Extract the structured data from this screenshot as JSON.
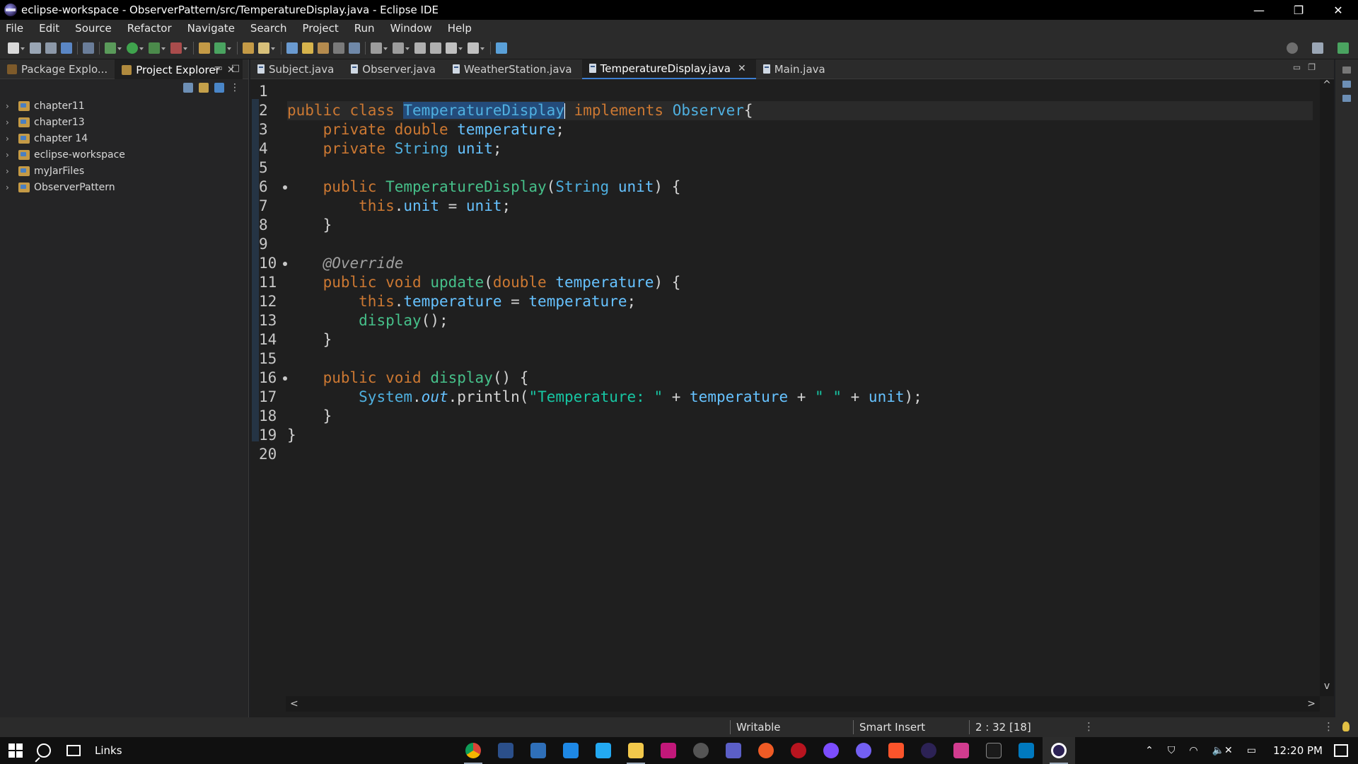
{
  "window": {
    "title": "eclipse-workspace - ObserverPattern/src/TemperatureDisplay.java - Eclipse IDE",
    "controls": {
      "minimize": "—",
      "restore": "❐",
      "close": "✕"
    }
  },
  "menu": [
    "File",
    "Edit",
    "Source",
    "Refactor",
    "Navigate",
    "Search",
    "Project",
    "Run",
    "Window",
    "Help"
  ],
  "left_panel": {
    "tabs": [
      {
        "label": "Package Explo..."
      },
      {
        "label": "Project Explorer",
        "close": "✕"
      }
    ],
    "projects": [
      "chapter11",
      "chapter13",
      "chapter 14",
      "eclipse-workspace",
      "myJarFiles",
      "ObserverPattern"
    ]
  },
  "editor": {
    "tabs": [
      {
        "label": "Subject.java"
      },
      {
        "label": "Observer.java"
      },
      {
        "label": "WeatherStation.java"
      },
      {
        "label": "TemperatureDisplay.java",
        "close": "✕"
      },
      {
        "label": "Main.java"
      }
    ],
    "line_numbers": [
      "1",
      "2",
      "3",
      "4",
      "5",
      "6",
      "7",
      "8",
      "9",
      "10",
      "11",
      "12",
      "13",
      "14",
      "15",
      "16",
      "17",
      "18",
      "19",
      "20"
    ],
    "code": {
      "l2": {
        "kw1": "public",
        "kw2": "class",
        "cls": "TemperatureDisplay",
        "kw3": "implements",
        "iface": "Observer",
        "brace": "{"
      },
      "l3": {
        "kw1": "private",
        "kw2": "double",
        "field": "temperature",
        "end": ";"
      },
      "l4": {
        "kw1": "private",
        "type": "String",
        "field": "unit",
        "end": ";"
      },
      "l6": {
        "kw1": "public",
        "ctor": "TemperatureDisplay",
        "open": "(",
        "type": "String",
        "param": "unit",
        "close": ") {"
      },
      "l7": {
        "kw": "this",
        "dot": ".",
        "field": "unit",
        "eq": " = ",
        "param": "unit",
        "end": ";"
      },
      "l8": {
        "brace": "}"
      },
      "l10": {
        "annotation": "@Override"
      },
      "l11": {
        "kw1": "public",
        "kw2": "void",
        "method": "update",
        "open": "(",
        "kw3": "double",
        "param": "temperature",
        "close": ") {"
      },
      "l12": {
        "kw": "this",
        "dot": ".",
        "field": "temperature",
        "eq": " = ",
        "param": "temperature",
        "end": ";"
      },
      "l13": {
        "method": "display",
        "end": "();"
      },
      "l14": {
        "brace": "}"
      },
      "l16": {
        "kw1": "public",
        "kw2": "void",
        "method": "display",
        "end": "() {"
      },
      "l17": {
        "cls": "System",
        "dot1": ".",
        "field": "out",
        "dot2": ".",
        "method": "println",
        "open": "(",
        "str1": "\"Temperature: \"",
        "plus1": " + ",
        "var1": "temperature",
        "plus2": " + ",
        "str2": "\" \"",
        "plus3": " + ",
        "var2": "unit",
        "end": ");"
      },
      "l18": {
        "brace": "}"
      },
      "l19": {
        "brace": "}"
      }
    },
    "scroll": {
      "up": "^",
      "down": "v",
      "left": "<",
      "right": ">"
    }
  },
  "status": {
    "writable": "Writable",
    "insert_mode": "Smart Insert",
    "position": "2 : 32 [18]"
  },
  "taskbar": {
    "links": "Links",
    "clock": "12:20 PM"
  },
  "colors": {
    "keyword": "#cc7832",
    "type": "#4fb0e0",
    "field": "#66c2ff",
    "method": "#46c08a",
    "string": "#17c6a3",
    "background": "#1f1f1f"
  }
}
